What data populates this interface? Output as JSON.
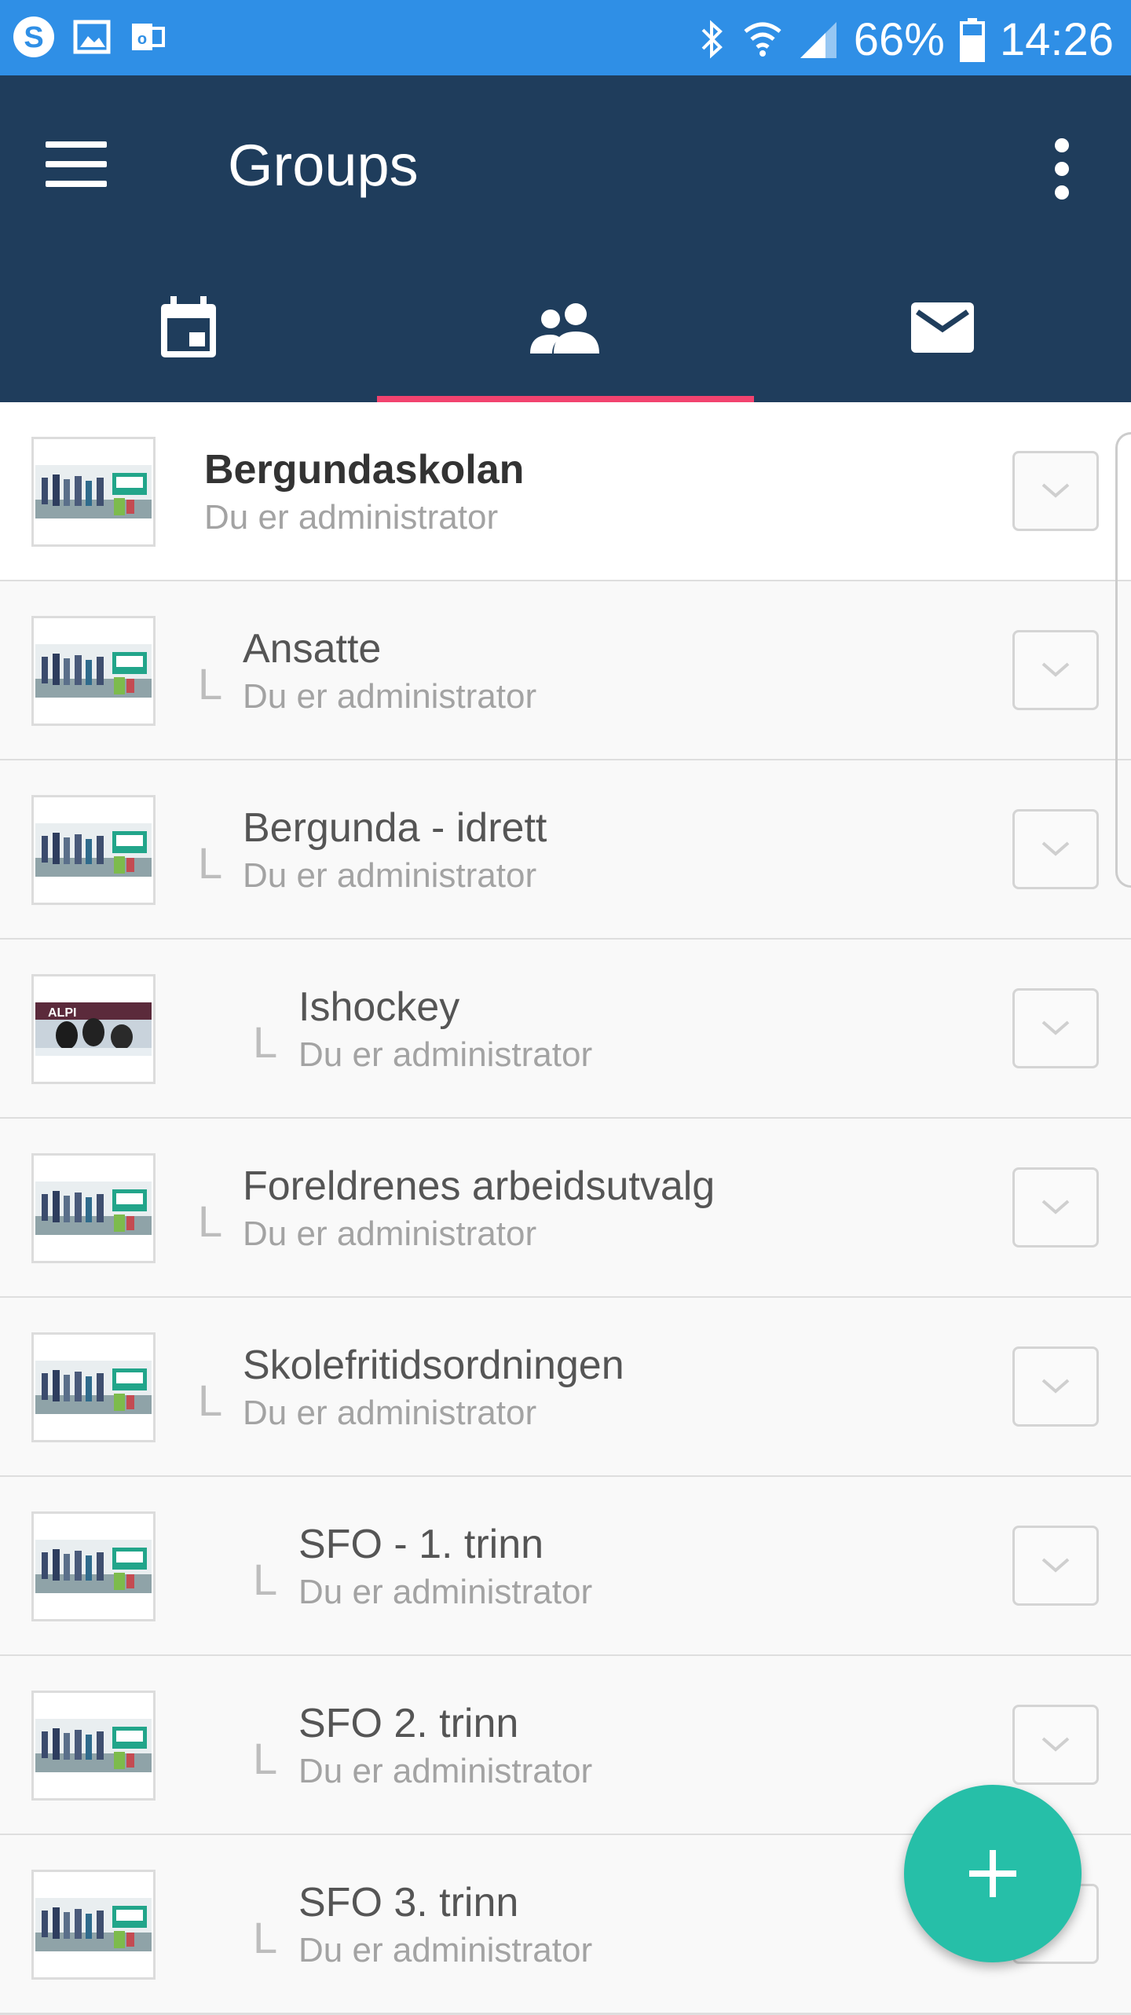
{
  "status_bar": {
    "battery": "66%",
    "time": "14:26",
    "left_icons": [
      "skype-icon",
      "gallery-icon",
      "outlook-icon"
    ],
    "right_icons": [
      "bluetooth-icon",
      "wifi-icon",
      "signal-icon",
      "battery-icon"
    ]
  },
  "app_bar": {
    "title": "Groups"
  },
  "tabs": [
    {
      "icon": "calendar-icon",
      "selected": false
    },
    {
      "icon": "people-icon",
      "selected": true
    },
    {
      "icon": "mail-icon",
      "selected": false
    }
  ],
  "groups": [
    {
      "name": "Bergundaskolan",
      "role": "Du er administrator",
      "level": 0,
      "thumb": "group-photo"
    },
    {
      "name": "Ansatte",
      "role": "Du er administrator",
      "level": 1,
      "thumb": "group-photo"
    },
    {
      "name": "Bergunda - idrett",
      "role": "Du er administrator",
      "level": 1,
      "thumb": "group-photo"
    },
    {
      "name": "Ishockey",
      "role": "Du er administrator",
      "level": 2,
      "thumb": "hockey-photo"
    },
    {
      "name": "Foreldrenes arbeidsutvalg",
      "role": "Du er administrator",
      "level": 1,
      "thumb": "group-photo"
    },
    {
      "name": "Skolefritidsordningen",
      "role": "Du er administrator",
      "level": 1,
      "thumb": "group-photo"
    },
    {
      "name": "SFO - 1. trinn",
      "role": "Du er administrator",
      "level": 2,
      "thumb": "group-photo"
    },
    {
      "name": "SFO 2. trinn",
      "role": "Du er administrator",
      "level": 2,
      "thumb": "group-photo"
    },
    {
      "name": "SFO 3. trinn",
      "role": "Du er administrator",
      "level": 2,
      "thumb": "group-photo"
    }
  ],
  "hockey_thumb_text": "ALPI",
  "colors": {
    "status_bar": "#2f8fe6",
    "app_bar": "#1f3d5c",
    "tab_indicator": "#f2436f",
    "fab": "#26bfa8"
  },
  "fab": {
    "icon": "plus-icon"
  }
}
